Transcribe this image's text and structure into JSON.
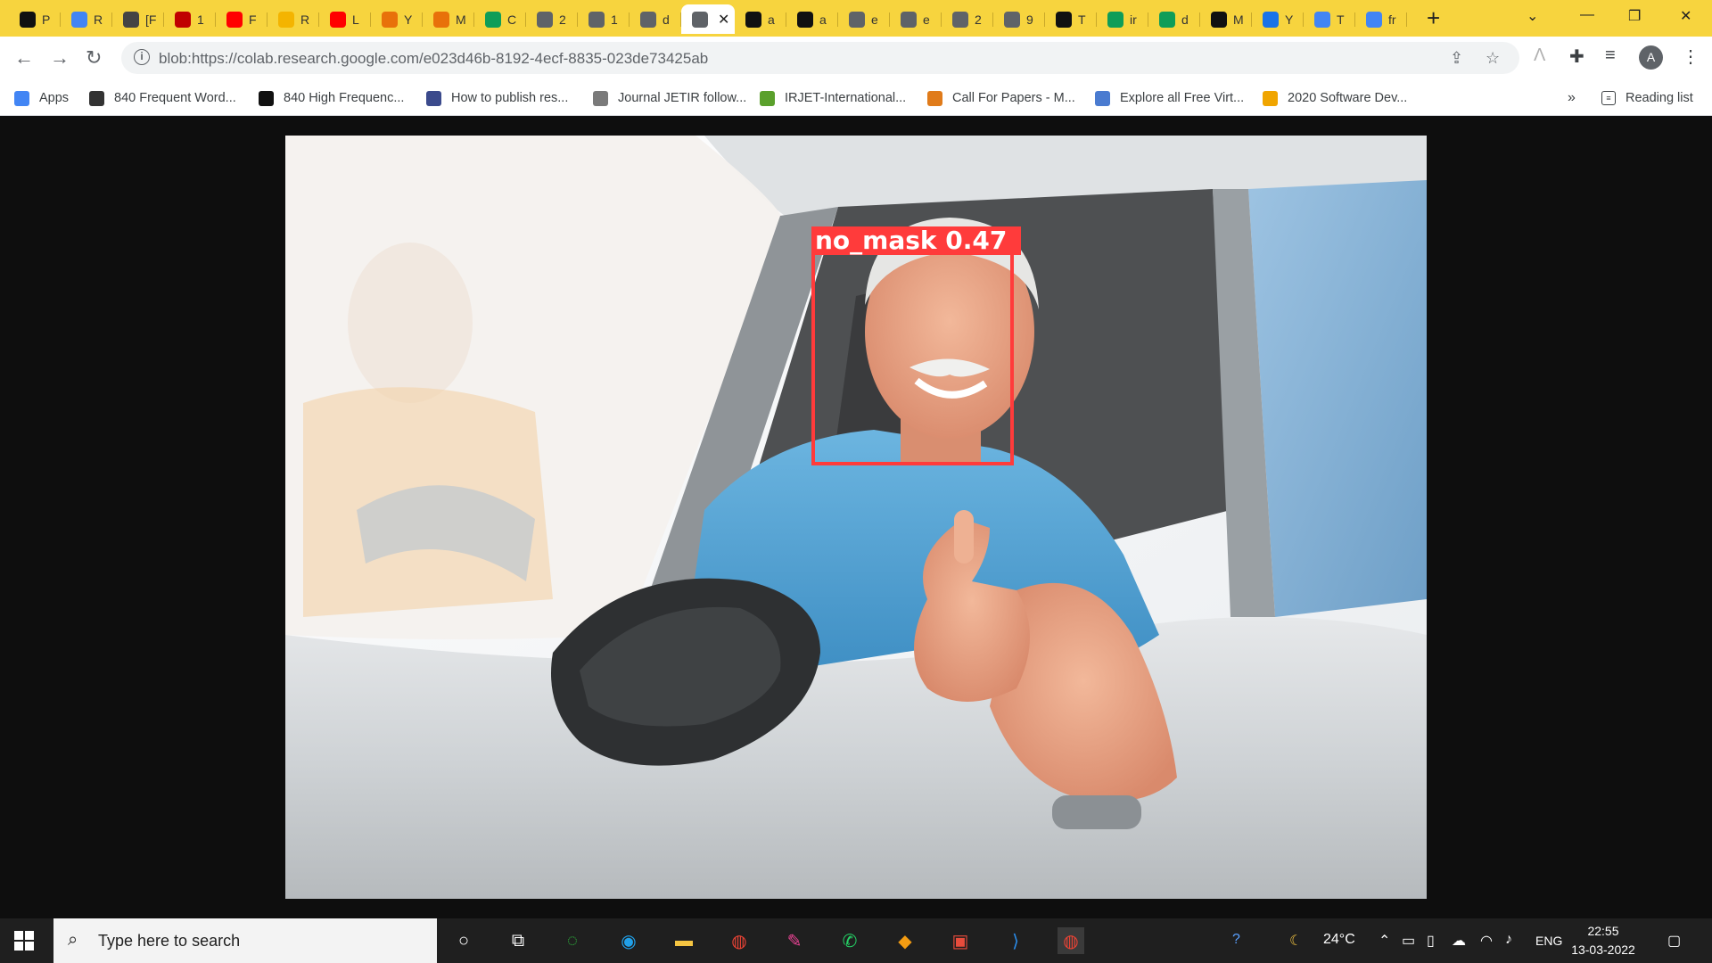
{
  "browser": {
    "tabs": [
      {
        "letter": "P",
        "icon": "notion-icon",
        "color": "#111111"
      },
      {
        "letter": "R",
        "icon": "docs-icon",
        "color": "#4285f4"
      },
      {
        "letter": "[F",
        "icon": "hook-icon",
        "color": "#444444"
      },
      {
        "letter": "1",
        "icon": "pdf-icon",
        "color": "#c00000"
      },
      {
        "letter": "F",
        "icon": "youtube-icon",
        "color": "#ff0000"
      },
      {
        "letter": "R",
        "icon": "slides-icon",
        "color": "#f4b400"
      },
      {
        "letter": "L",
        "icon": "youtube-icon",
        "color": "#ff0000"
      },
      {
        "letter": "Y",
        "icon": "colab-icon",
        "color": "#e8710a"
      },
      {
        "letter": "M",
        "icon": "colab-icon",
        "color": "#e8710a"
      },
      {
        "letter": "C",
        "icon": "drive-icon",
        "color": "#0f9d58"
      },
      {
        "letter": "2",
        "icon": "globe-icon",
        "color": "#5f6368"
      },
      {
        "letter": "1",
        "icon": "globe-icon",
        "color": "#5f6368"
      },
      {
        "letter": "d",
        "icon": "globe-icon",
        "color": "#5f6368"
      },
      {
        "letter": "",
        "icon": "globe-icon",
        "color": "#5f6368",
        "active": true
      },
      {
        "letter": "a",
        "icon": "github-icon",
        "color": "#111111"
      },
      {
        "letter": "a",
        "icon": "github-icon",
        "color": "#111111"
      },
      {
        "letter": "e",
        "icon": "globe-icon",
        "color": "#5f6368"
      },
      {
        "letter": "e",
        "icon": "globe-icon",
        "color": "#5f6368"
      },
      {
        "letter": "2",
        "icon": "globe-icon",
        "color": "#5f6368"
      },
      {
        "letter": "9",
        "icon": "globe-icon",
        "color": "#5f6368"
      },
      {
        "letter": "T",
        "icon": "github-icon",
        "color": "#111111"
      },
      {
        "letter": "ir",
        "icon": "drive-icon",
        "color": "#0f9d58"
      },
      {
        "letter": "d",
        "icon": "drive-icon",
        "color": "#0f9d58"
      },
      {
        "letter": "M",
        "icon": "terminal-icon",
        "color": "#111111"
      },
      {
        "letter": "Y",
        "icon": "k-icon",
        "color": "#1a73e8"
      },
      {
        "letter": "T",
        "icon": "google-icon",
        "color": "#4285f4"
      },
      {
        "letter": "fr",
        "icon": "google-icon",
        "color": "#4285f4"
      }
    ],
    "new_tab": "+",
    "url": "blob:https://colab.research.google.com/e023d46b-8192-4ecf-8835-023de73425ab",
    "profile_initial": "A",
    "bookmarks": [
      {
        "label": "Apps",
        "icon": "apps-grid-icon",
        "color": "#4285f4"
      },
      {
        "label": "840 Frequent Word...",
        "icon": "g-script-icon",
        "color": "#333333"
      },
      {
        "label": "840 High Frequenc...",
        "icon": "globe-icon",
        "color": "#111111"
      },
      {
        "label": "How to publish res...",
        "icon": "molecule-icon",
        "color": "#3b4a8c"
      },
      {
        "label": "Journal JETIR follow...",
        "icon": "shield-icon",
        "color": "#7a7a7a"
      },
      {
        "label": "IRJET-International...",
        "icon": "irjet-icon",
        "color": "#5aa02c"
      },
      {
        "label": "Call For Papers - M...",
        "icon": "e-icon",
        "color": "#e07b1a"
      },
      {
        "label": "Explore all Free Virt...",
        "icon": "gem-icon",
        "color": "#4a7bd0"
      },
      {
        "label": "2020 Software Dev...",
        "icon": "spark-icon",
        "color": "#f0a500"
      }
    ],
    "more_bookmarks": "»",
    "reading_list": "Reading list"
  },
  "image": {
    "detection": {
      "label": "no_mask 0.47",
      "color": "#ff3b3b"
    }
  },
  "taskbar": {
    "search_placeholder": "Type here to search",
    "weather": "24°C",
    "language": "ENG",
    "time": "22:55",
    "date": "13-03-2022"
  }
}
